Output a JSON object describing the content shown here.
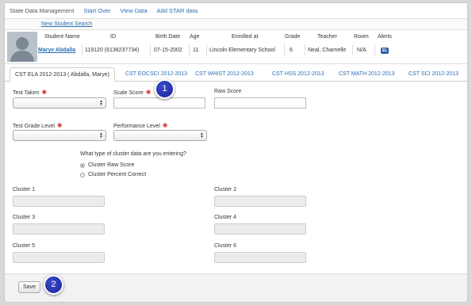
{
  "nav": {
    "brand": "State Data Management",
    "links": [
      "Start Over",
      "View Data",
      "Add STAR data"
    ],
    "new_student": "New Student Search"
  },
  "student": {
    "headers": [
      "Student Name",
      "ID",
      "Birth Date",
      "Age",
      "Enrolled at",
      "Grade",
      "Teacher",
      "Room",
      "Alerts"
    ],
    "name": "Marye Abdalla",
    "id": "119120 (6138237734)",
    "birth_date": "07-15-2002",
    "age": "11",
    "enrolled_at": "Lincoln Elementary School",
    "grade": "6",
    "teacher": "Neal, Charnelle",
    "room": "N/A",
    "alert_badge": "EL"
  },
  "tabs": [
    "CST ELA 2012-2013 ( Abdalla, Marye)",
    "CST EOCSCI 2012-2013",
    "CST WHIST 2012-2013",
    "CST HSS 2012-2013",
    "CST MATH 2012-2013",
    "CST SCI 2012-2013"
  ],
  "form": {
    "test_taken": "Test Taken",
    "scale_score": "Scale Score",
    "raw_score": "Raw Score",
    "test_grade_level": "Test Grade Level",
    "performance_level": "Performance Level",
    "required_mark": "✱",
    "cluster_question": "What type of cluster data are you entering?",
    "cluster_options": [
      "Cluster Raw Score",
      "Cluster Percent Correct"
    ],
    "clusters": [
      "Cluster 1",
      "Cluster 2",
      "Cluster 3",
      "Cluster 4",
      "Cluster 5",
      "Cluster 6"
    ]
  },
  "footer": {
    "save": "Save"
  },
  "markers": [
    "1",
    "2"
  ],
  "colors": {
    "link": "#2a6fb5",
    "required": "#d9352b",
    "marker": "#1f2aa8"
  }
}
